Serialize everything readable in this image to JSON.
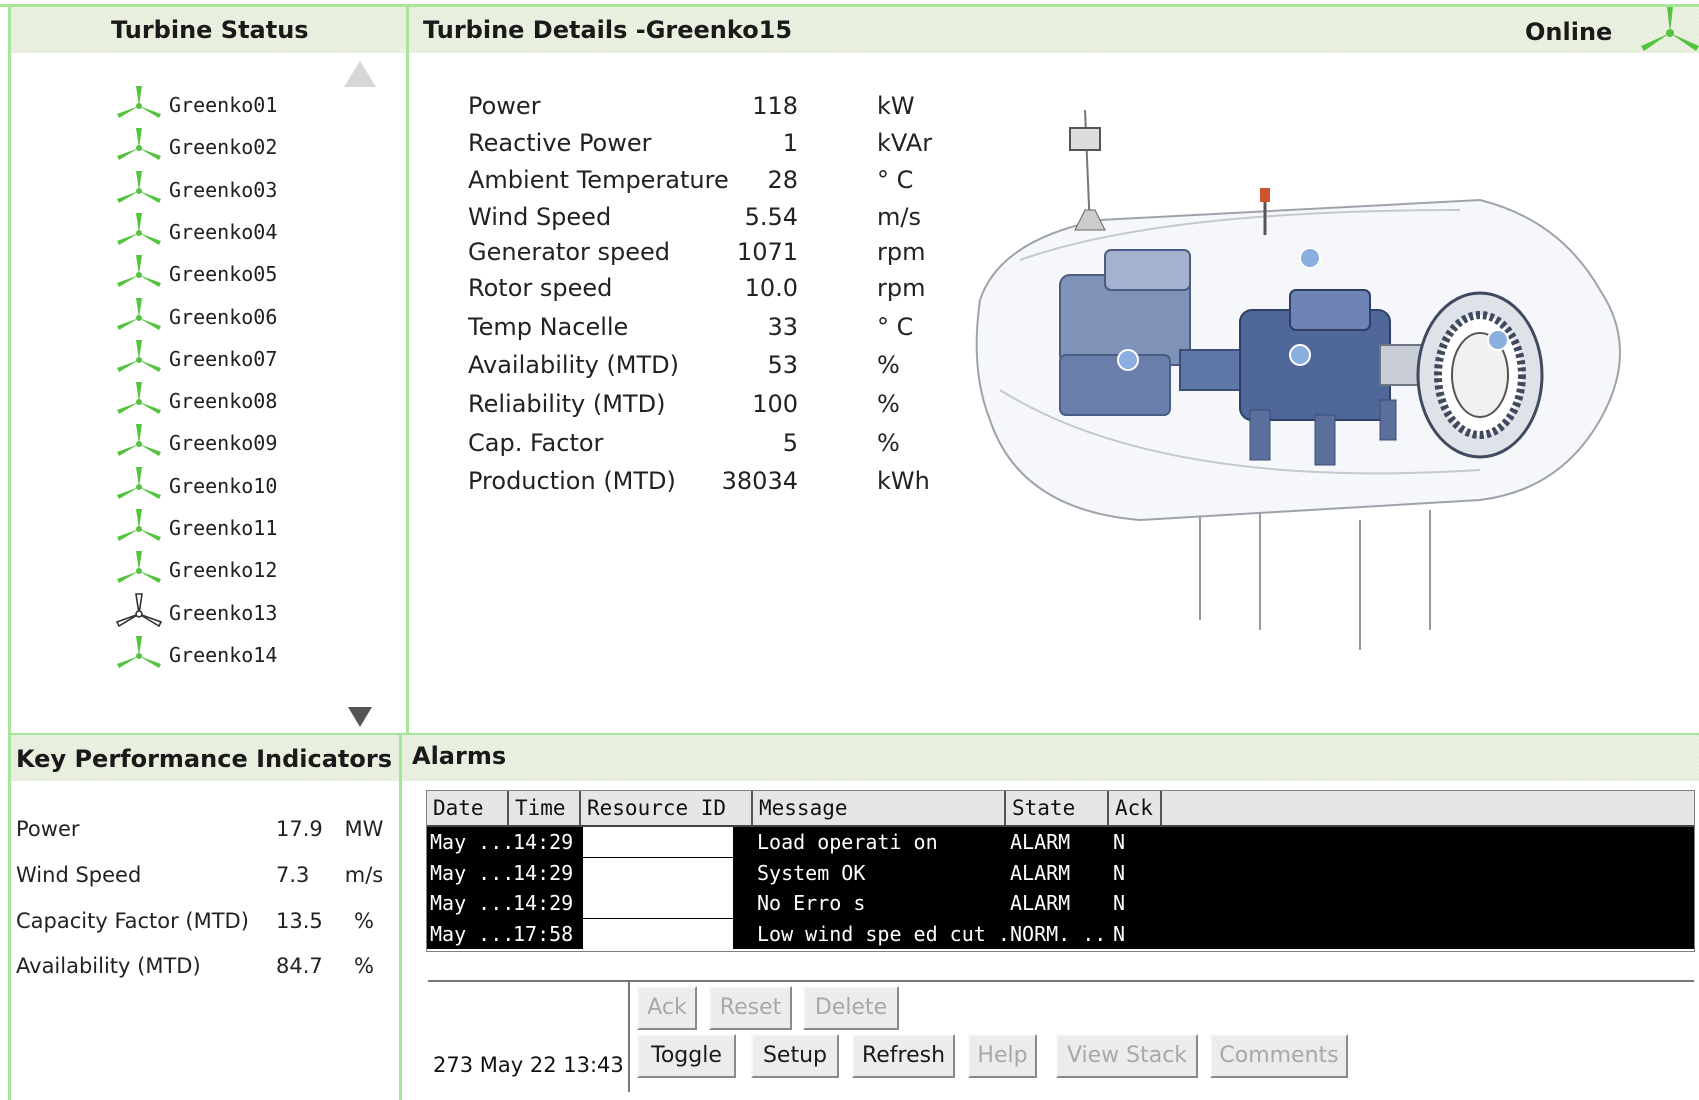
{
  "turbine_status": {
    "title": "Turbine Status",
    "turbines": [
      {
        "name": "Greenko01",
        "status": "online"
      },
      {
        "name": "Greenko02",
        "status": "online"
      },
      {
        "name": "Greenko03",
        "status": "online"
      },
      {
        "name": "Greenko04",
        "status": "online"
      },
      {
        "name": "Greenko05",
        "status": "online"
      },
      {
        "name": "Greenko06",
        "status": "online"
      },
      {
        "name": "Greenko07",
        "status": "online"
      },
      {
        "name": "Greenko08",
        "status": "online"
      },
      {
        "name": "Greenko09",
        "status": "online"
      },
      {
        "name": "Greenko10",
        "status": "online"
      },
      {
        "name": "Greenko11",
        "status": "online"
      },
      {
        "name": "Greenko12",
        "status": "online"
      },
      {
        "name": "Greenko13",
        "status": "offline"
      },
      {
        "name": "Greenko14",
        "status": "online"
      }
    ]
  },
  "details": {
    "title": "Turbine Details  -Greenko15",
    "status_label": "Online",
    "rows": [
      {
        "label": "Power",
        "value": "118",
        "unit": "kW"
      },
      {
        "label": "Reactive Power",
        "value": "1",
        "unit": "kVAr"
      },
      {
        "label": "Ambient Temperature",
        "value": "28",
        "unit": "° C"
      },
      {
        "label": "Wind Speed",
        "value": "5.54",
        "unit": "m/s"
      },
      {
        "label": "Generator speed",
        "value": "1071",
        "unit": "rpm"
      },
      {
        "label": "Rotor speed",
        "value": "10.0",
        "unit": "rpm"
      },
      {
        "label": "Temp Nacelle",
        "value": "33",
        "unit": "° C"
      },
      {
        "label": "Availability (MTD)",
        "value": "53",
        "unit": "%"
      },
      {
        "label": "Reliability (MTD)",
        "value": "100",
        "unit": "%"
      },
      {
        "label": "Cap. Factor",
        "value": "5",
        "unit": "%"
      },
      {
        "label": "Production (MTD)",
        "value": "38034",
        "unit": "kWh"
      }
    ]
  },
  "kpi": {
    "title": "Key Performance Indicators",
    "rows": [
      {
        "label": "Power",
        "value": "17.9",
        "unit": "MW"
      },
      {
        "label": "Wind Speed",
        "value": "7.3",
        "unit": "m/s"
      },
      {
        "label": "Capacity Factor (MTD)",
        "value": "13.5",
        "unit": "%"
      },
      {
        "label": "Availability (MTD)",
        "value": "84.7",
        "unit": "%"
      }
    ]
  },
  "alarms": {
    "title": "Alarms",
    "columns": [
      "Date",
      "Time",
      "Resource ID",
      "Message",
      "State",
      "Ack"
    ],
    "rows": [
      {
        "date": "May ...",
        "time": "14:29",
        "resource": "",
        "message": "Load operati on",
        "state": "ALARM",
        "ack": "N"
      },
      {
        "date": "May ...",
        "time": "14:29",
        "resource": "",
        "message": "System OK",
        "state": "ALARM",
        "ack": "N"
      },
      {
        "date": "May ...",
        "time": "14:29",
        "resource": "",
        "message": "No Erro s",
        "state": "ALARM",
        "ack": "N"
      },
      {
        "date": "May ...",
        "time": "17:58",
        "resource": "",
        "message": "Low wind spe ed cut ...",
        "state": "NORM. ..",
        "ack": "N"
      }
    ],
    "footer_text": "273 May 22 13:43",
    "buttons": {
      "ack": "Ack",
      "reset": "Reset",
      "delete": "Delete",
      "toggle": "Toggle",
      "setup": "Setup",
      "refresh": "Refresh",
      "help": "Help",
      "view_stack": "View Stack",
      "comments": "Comments"
    }
  },
  "colors": {
    "accent_green": "#54c43f",
    "border_green": "#a6e59a",
    "header_bg": "#ecf2e1",
    "offline_icon": "#333333"
  }
}
